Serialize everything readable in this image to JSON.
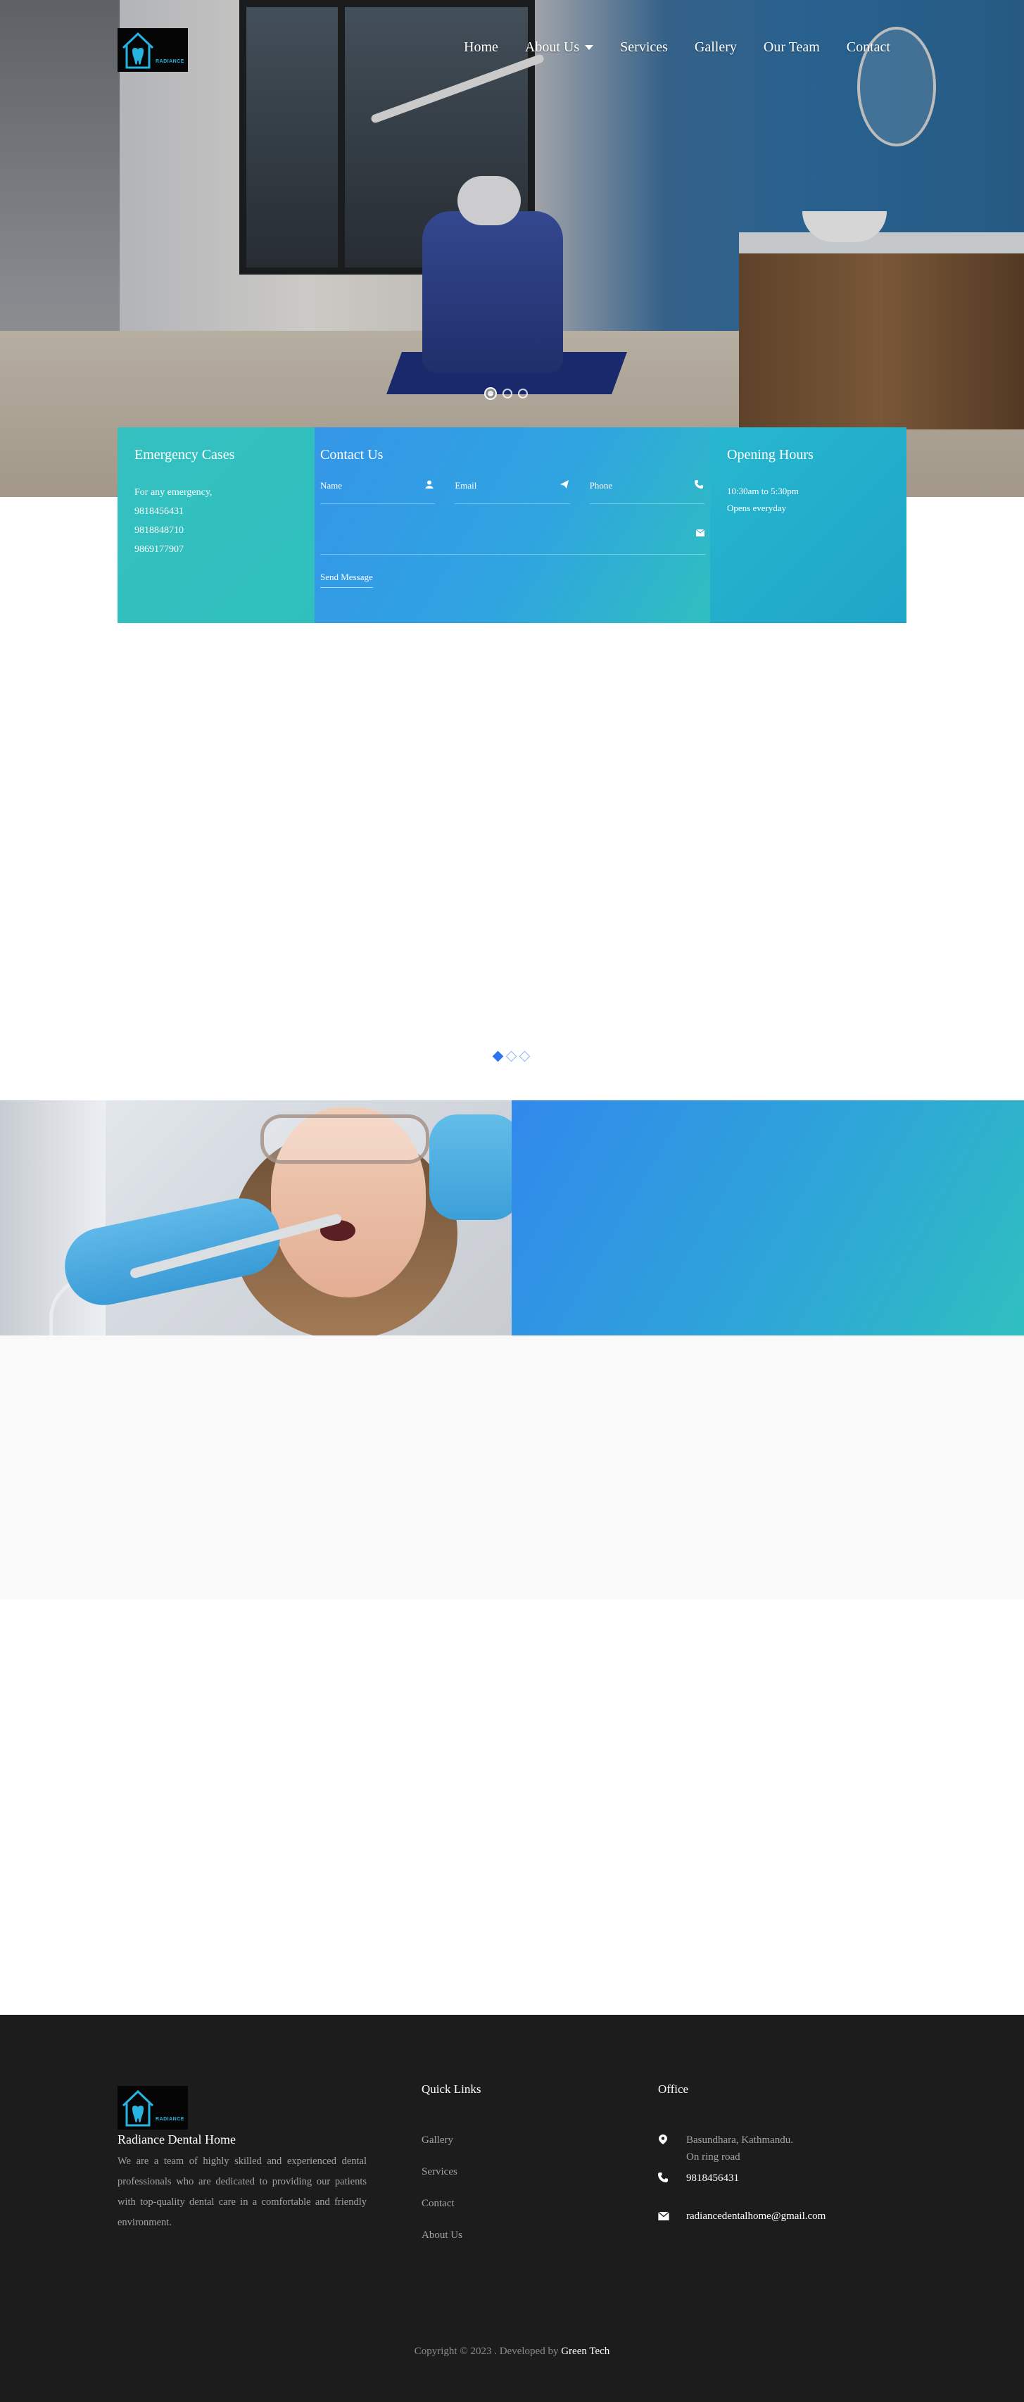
{
  "brand": {
    "logo_text": "RADIANCE",
    "name": "Radiance Dental Home"
  },
  "nav": {
    "items": [
      "Home",
      "About Us",
      "Services",
      "Gallery",
      "Our Team",
      "Contact"
    ]
  },
  "emergency": {
    "title": "Emergency Cases",
    "intro": "For any emergency,",
    "phones": [
      "9818456431",
      "9818848710",
      "9869177907"
    ]
  },
  "contact_form": {
    "title": "Contact Us",
    "name_placeholder": "Name",
    "email_placeholder": "Email",
    "phone_placeholder": "Phone",
    "send_label": "Send Message"
  },
  "hours": {
    "title": "Opening Hours",
    "time": "10:30am to 5:30pm",
    "days": "Opens everyday"
  },
  "footer": {
    "about": "We are a team of highly skilled and experienced dental professionals who are dedicated to providing our patients with top-quality dental care in a comfortable and friendly environment.",
    "quick_links_title": "Quick Links",
    "quick_links": [
      "Gallery",
      "Services",
      "Contact",
      "About Us"
    ],
    "office_title": "Office",
    "address_line1": "Basundhara, Kathmandu.",
    "address_line2": "On ring road",
    "phone": "9818456431",
    "email": "radiancedentalhome@gmail.com",
    "copyright": "Copyright © 2023 . Developed by",
    "developer": "Green Tech"
  },
  "colors": {
    "teal": "#2fbfbf",
    "blue": "#3189ec",
    "footer_bg": "#1c1c1c"
  },
  "icons": [
    "user-icon",
    "send-icon",
    "phone-icon",
    "envelope-icon",
    "map-marker-icon",
    "caret-down-icon"
  ]
}
